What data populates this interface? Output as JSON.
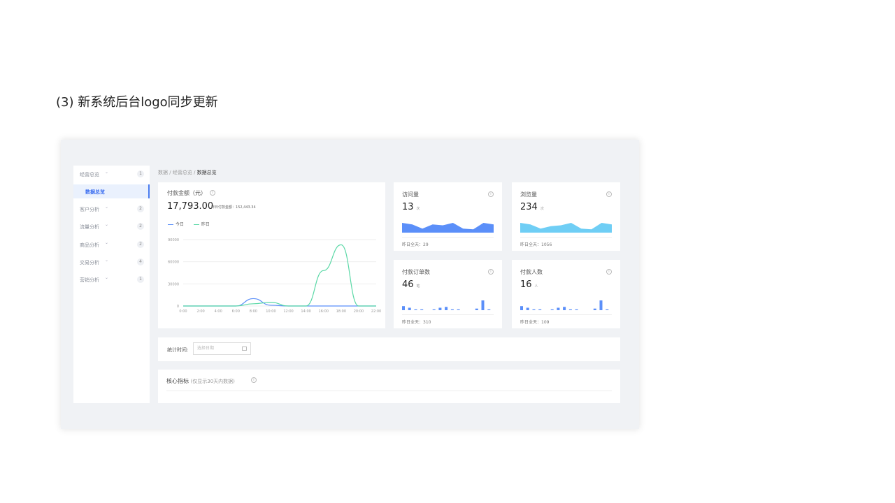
{
  "caption": "(3) 新系统后台logo同步更新",
  "sidebar": {
    "items": [
      {
        "label": "经营总览",
        "badge": "1",
        "active": false
      },
      {
        "label": "数据总览",
        "badge": "",
        "active": true
      },
      {
        "label": "客户分析",
        "badge": "2",
        "active": false
      },
      {
        "label": "流量分析",
        "badge": "2",
        "active": false
      },
      {
        "label": "商品分析",
        "badge": "2",
        "active": false
      },
      {
        "label": "交易分析",
        "badge": "4",
        "active": false
      },
      {
        "label": "营销分析",
        "badge": "1",
        "active": false
      }
    ]
  },
  "breadcrumb": {
    "part1": "数据",
    "part2": "经营总览",
    "current": "数据总览",
    "sep": "/"
  },
  "pay_card": {
    "title": "付款金额（元）",
    "value": "17,793.00",
    "yesterday_label": "昨日付款金额：",
    "yesterday_value": "152,443.34",
    "legend_today": "今日",
    "legend_yesterday": "昨日"
  },
  "chart_data": {
    "type": "line",
    "x": [
      "0:00",
      "2:00",
      "4:00",
      "6:00",
      "8:00",
      "10:00",
      "12:00",
      "14:00",
      "16:00",
      "18:00",
      "20:00",
      "22:00"
    ],
    "yticks": [
      "90000",
      "60000",
      "30000",
      "0"
    ],
    "ylim": [
      0,
      90000
    ],
    "series": [
      {
        "name": "今日",
        "color": "#5b8ff9",
        "values": [
          0,
          0,
          0,
          0,
          10000,
          1000,
          0,
          0,
          0,
          0,
          0,
          0
        ]
      },
      {
        "name": "昨日",
        "color": "#5ad8a6",
        "values": [
          0,
          0,
          0,
          0,
          3000,
          5000,
          0,
          0,
          48000,
          83000,
          0,
          0
        ]
      }
    ]
  },
  "stats": [
    {
      "title": "访问量",
      "value": "13",
      "unit": "次",
      "foot_label": "昨日全天：",
      "foot_value": "29",
      "color": "#5b8ff9",
      "kind": "area",
      "values": [
        12,
        10,
        5,
        10,
        9,
        12,
        5,
        4,
        12,
        10
      ]
    },
    {
      "title": "浏览量",
      "value": "234",
      "unit": "次",
      "foot_label": "昨日全天：",
      "foot_value": "1056",
      "color": "#6fcef5",
      "kind": "area",
      "values": [
        12,
        10,
        5,
        8,
        9,
        12,
        5,
        4,
        12,
        10
      ]
    },
    {
      "title": "付款订单数",
      "value": "46",
      "unit": "笔",
      "foot_label": "昨日全天：",
      "foot_value": "310",
      "color": "#5b8ff9",
      "kind": "bar",
      "values": [
        5,
        3,
        1,
        1,
        0,
        1,
        3,
        4,
        1,
        1,
        0,
        0,
        2,
        12,
        1
      ]
    },
    {
      "title": "付款人数",
      "value": "16",
      "unit": "人",
      "foot_label": "昨日全天：",
      "foot_value": "109",
      "color": "#5b8ff9",
      "kind": "bar",
      "values": [
        5,
        3,
        1,
        1,
        0,
        1,
        3,
        4,
        1,
        1,
        0,
        0,
        2,
        12,
        1
      ]
    }
  ],
  "filter": {
    "label": "统计时间:",
    "placeholder": "选择日期"
  },
  "core": {
    "title": "核心指标",
    "subtitle": "(仅显示30天内数据)"
  }
}
